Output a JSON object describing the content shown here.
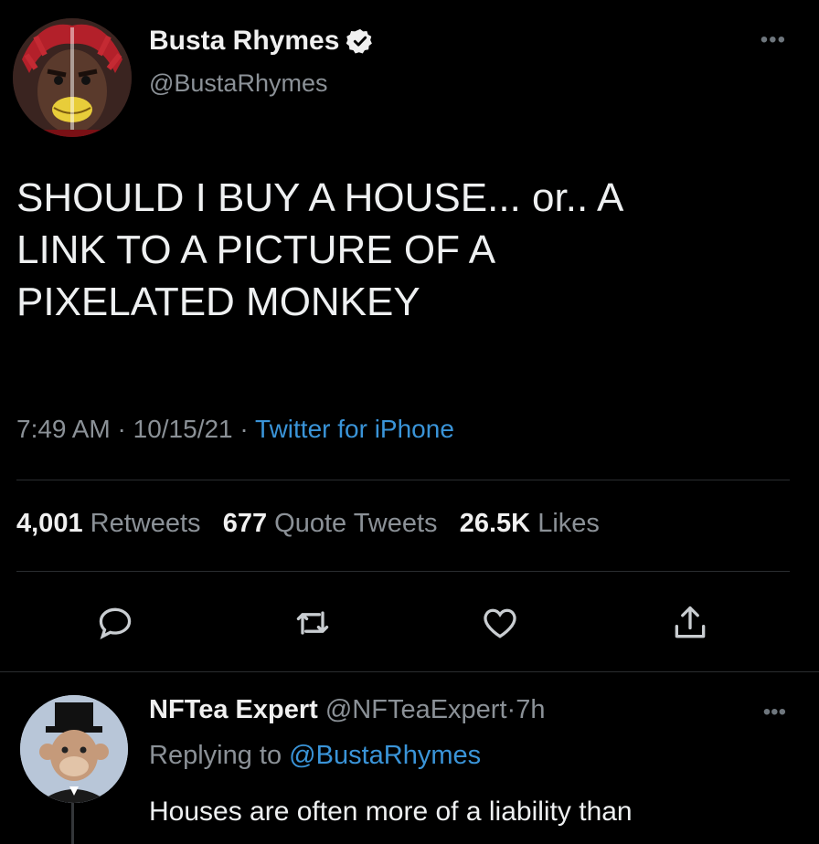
{
  "tweet": {
    "display_name": "Busta Rhymes",
    "handle": "@BustaRhymes",
    "verified": true,
    "more_icon": "more-icon",
    "text": "SHOULD I BUY A HOUSE... or.. A\nLINK TO A PICTURE OF A\nPIXELATED MONKEY",
    "time": "7:49 AM",
    "date": "10/15/21",
    "separator": "·",
    "source": "Twitter for iPhone",
    "stats": {
      "retweets_count": "4,001",
      "retweets_label": "Retweets",
      "quotes_count": "677",
      "quotes_label": "Quote Tweets",
      "likes_count": "26.5K",
      "likes_label": "Likes"
    },
    "actions": [
      "reply-icon",
      "retweet-icon",
      "like-icon",
      "share-icon"
    ]
  },
  "reply": {
    "display_name": "NFTea Expert",
    "handle": "@NFTeaExpert",
    "separator": "·",
    "time": "7h",
    "replying_prefix": "Replying to",
    "replying_to": "@BustaRhymes",
    "text": "Houses are often more of a liability than"
  },
  "colors": {
    "background": "#000000",
    "accent": "#3a94d8",
    "muted": "#8b9197",
    "text": "#e7e9ea"
  }
}
